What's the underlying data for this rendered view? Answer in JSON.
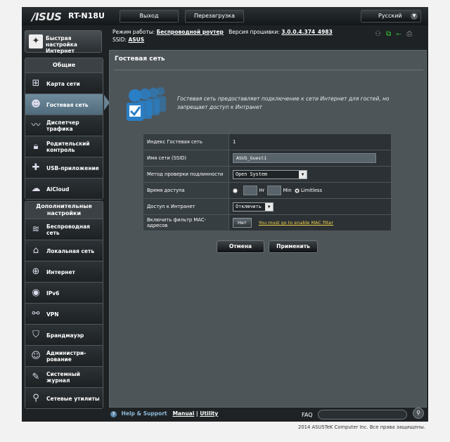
{
  "header": {
    "brand": "/ISUS",
    "model": "RT-N18U",
    "logout_label": "Выход",
    "reboot_label": "Перезагрузка",
    "language": "Русский"
  },
  "info": {
    "mode_label": "Режим работы:",
    "mode_value": "Беспроводной роутер",
    "fw_label": "Версия прошивки:",
    "fw_value": "3.0.0.4.374_4983",
    "ssid_label": "SSID:",
    "ssid_value": "ASUS"
  },
  "qis": {
    "label": "Быстрая настройка Интернет"
  },
  "general": {
    "heading": "Общие",
    "items": [
      {
        "label": "Карта сети",
        "icon": "network-map-icon"
      },
      {
        "label": "Гостевая сеть",
        "icon": "guest-network-icon"
      },
      {
        "label": "Диспетчер трафика",
        "icon": "traffic-manager-icon"
      },
      {
        "label": "Родительский контроль",
        "icon": "parental-lock-icon"
      },
      {
        "label": "USB-приложение",
        "icon": "usb-puzzle-icon"
      },
      {
        "label": "AiCloud",
        "icon": "aicloud-icon"
      }
    ]
  },
  "advanced": {
    "heading": "Дополнительные настройки",
    "items": [
      {
        "label": "Беспроводная сеть",
        "icon": "wireless-icon"
      },
      {
        "label": "Локальная сеть",
        "icon": "home-lan-icon"
      },
      {
        "label": "Интернет",
        "icon": "globe-icon"
      },
      {
        "label": "IPv6",
        "icon": "ipv6-icon"
      },
      {
        "label": "VPN",
        "icon": "vpn-icon"
      },
      {
        "label": "Брандмауэр",
        "icon": "firewall-shield-icon"
      },
      {
        "label": "Администри-рование",
        "icon": "admin-user-icon"
      },
      {
        "label": "Системный журнал",
        "icon": "syslog-icon"
      },
      {
        "label": "Сетевые утилиты",
        "icon": "network-tools-icon"
      }
    ]
  },
  "main": {
    "title": "Гостевая сеть",
    "description": "Гостевая сеть предоставляет подключение к сети Интернет для гостей, но запрещает доступ к Интранет",
    "form": {
      "index_label": "Индекс Гостевая сеть",
      "index_value": "1",
      "ssid_label": "Имя сети (SSID)",
      "ssid_value": "ASUS_Guest1",
      "auth_label": "Метод проверки подлинности",
      "auth_value": "Open System",
      "access_time_label": "Время доступа",
      "hr_label": "Hr",
      "min_label": "Min",
      "limitless_label": "Limitless",
      "intranet_label": "Доступ к Интранет",
      "intranet_value": "Отключить",
      "mac_label": "Включить фильтр MAC-адресов",
      "mac_value": "Нет",
      "mac_link": "You must go to enable MAC filter"
    },
    "cancel_label": "Отмена",
    "apply_label": "Применить"
  },
  "footer": {
    "help_label": "Help & Support",
    "manual_label": "Manual",
    "separator": "|",
    "utility_label": "Utility",
    "faq_label": "FAQ",
    "copyright": "2014 ASUSTeK Computer Inc. Все права защищены."
  }
}
